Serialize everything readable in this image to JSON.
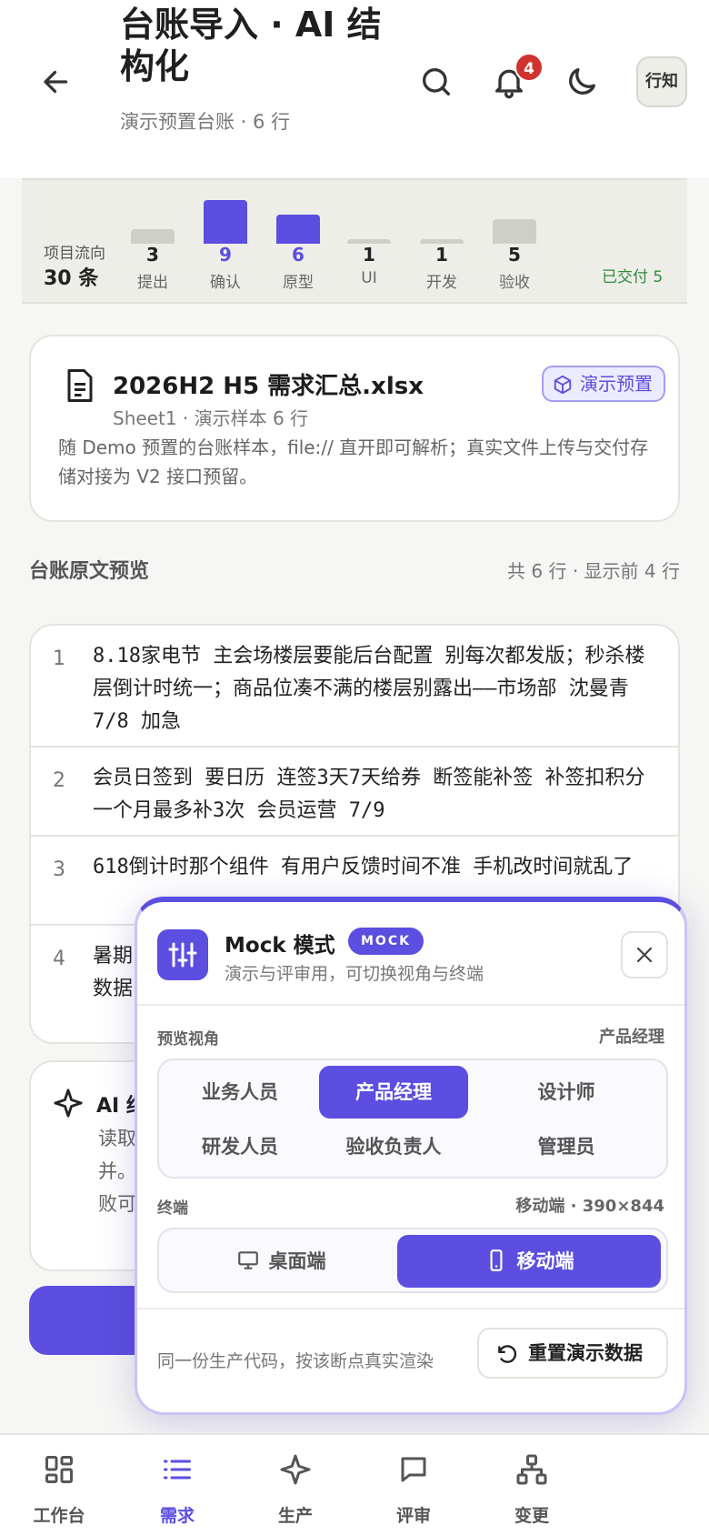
{
  "header": {
    "title": "台账导入 · AI 结构化",
    "subtitle": "演示预置台账 · 6 行",
    "notification_count": "4",
    "avatar_label": "行知"
  },
  "flow": {
    "label": "项目流向",
    "count": "30 条",
    "stages": [
      {
        "name": "提出",
        "count": "3",
        "active": false,
        "level": 3
      },
      {
        "name": "确认",
        "count": "9",
        "active": true,
        "level": 9
      },
      {
        "name": "原型",
        "count": "6",
        "active": true,
        "level": 6
      },
      {
        "name": "UI",
        "count": "1",
        "active": false,
        "level": 1
      },
      {
        "name": "开发",
        "count": "1",
        "active": false,
        "level": 1
      },
      {
        "name": "验收",
        "count": "5",
        "active": false,
        "level": 5
      }
    ],
    "delivered": "已交付 5"
  },
  "file": {
    "name": "2026H2 H5 需求汇总.xlsx",
    "meta": "Sheet1 · 演示样本 6 行",
    "badge": "演示预置",
    "description": "随 Demo 预置的台账样本，file:// 直开即可解析；真实文件上传与交付存储对接为 V2 接口预留。"
  },
  "preview": {
    "title": "台账原文预览",
    "info": "共 6 行 · 显示前 4 行",
    "rows": [
      {
        "index": "1",
        "text": "8.18家电节 主会场楼层要能后台配置 别每次都发版；秒杀楼层倒计时统一；商品位凑不满的楼层别露出——市场部 沈曼青 7/8 加急"
      },
      {
        "index": "2",
        "text": "会员日签到 要日历 连签3天7天给券 断签能补签 补签扣积分 一个月最多补3次 会员运营 7/9"
      },
      {
        "index": "3",
        "text": "618倒计时那个组件 有用户反馈时间不准 手机改时间就乱了"
      },
      {
        "index": "4",
        "text": "暑期"
      },
      {
        "index": "",
        "text": "数据"
      }
    ]
  },
  "ai": {
    "title": "AI 结",
    "lines": [
      "读取",
      "并。",
      "败可"
    ]
  },
  "mock": {
    "title": "Mock 模式",
    "badge": "MOCK",
    "subtitle": "演示与评审用，可切换视角与终端",
    "role_label": "预览视角",
    "role_value": "产品经理",
    "roles": [
      "业务人员",
      "产品经理",
      "设计师",
      "研发人员",
      "验收负责人",
      "管理员"
    ],
    "device_label": "终端",
    "device_value": "移动端 · 390×844",
    "devices": [
      "桌面端",
      "移动端"
    ],
    "footer": "同一份生产代码，按该断点真实渲染",
    "reset": "重置演示数据"
  },
  "tabs": [
    "工作台",
    "需求",
    "生产",
    "评审",
    "变更"
  ],
  "colors": {
    "accent": "#5b4ee0",
    "badge": "#d0322f",
    "delivered": "#2f8a3c"
  }
}
